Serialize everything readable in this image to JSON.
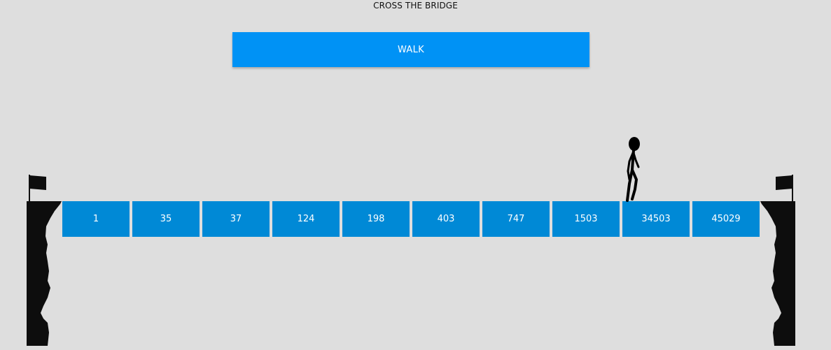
{
  "header": {
    "title": "CROSS THE BRIDGE"
  },
  "controls": {
    "walk_label": "WALK",
    "walk_color": "#0092f5"
  },
  "bridge": {
    "plank_color": "#0089d6",
    "planks": [
      "1",
      "35",
      "37",
      "124",
      "198",
      "403",
      "747",
      "1503",
      "34503",
      "45029"
    ],
    "walker_plank_index": 8
  },
  "scene": {
    "background": "#dedede",
    "cliff_color": "#0d0d0d",
    "left_flag_icon": "flag-icon",
    "right_flag_icon": "flag-icon",
    "walker_icon": "stick-figure-icon"
  }
}
